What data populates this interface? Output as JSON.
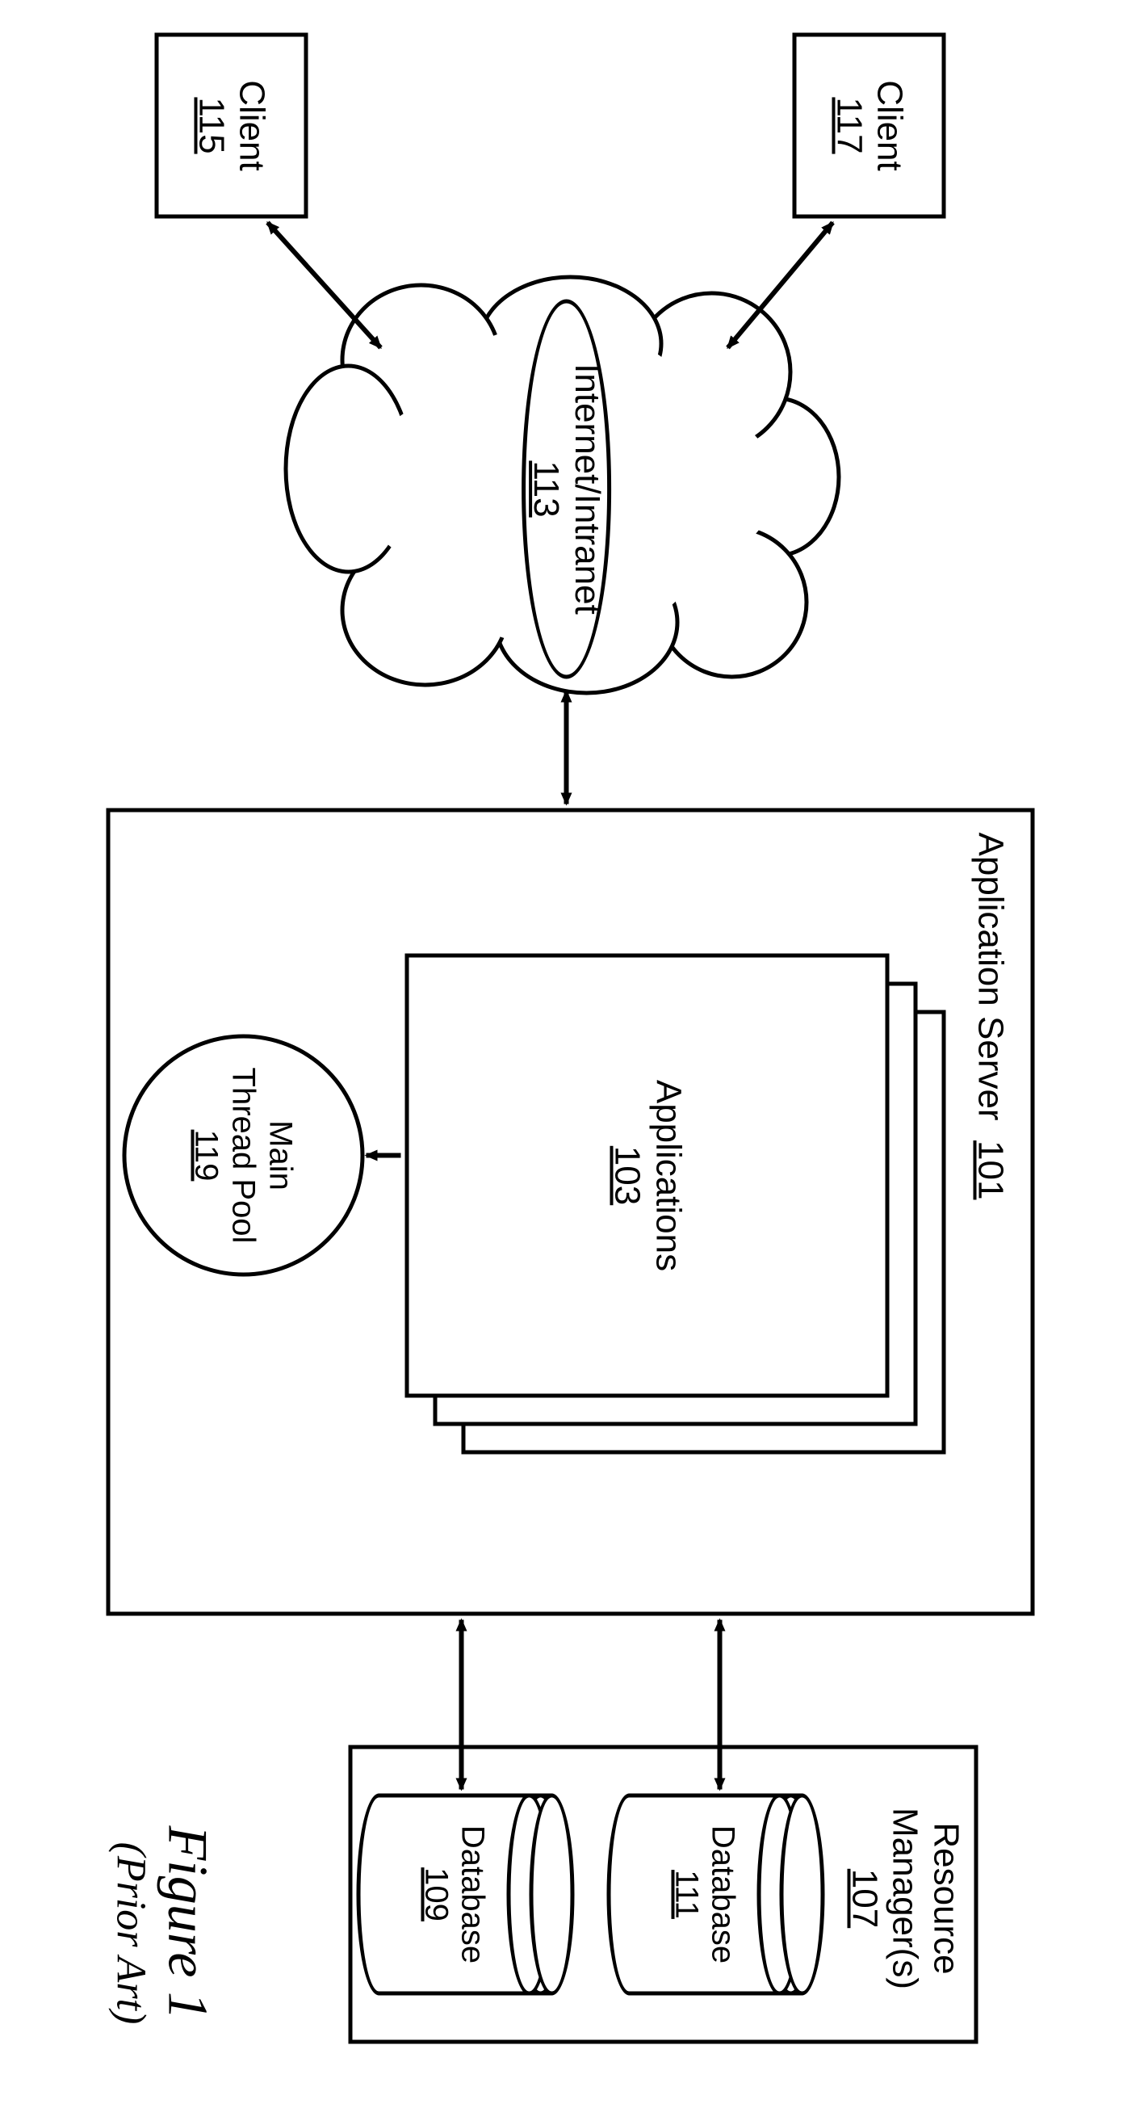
{
  "clients": [
    {
      "label": "Client",
      "id": "117"
    },
    {
      "label": "Client",
      "id": "115"
    }
  ],
  "network": {
    "label": "Internet/Intranet",
    "id": "113"
  },
  "app_server": {
    "title": "Application Server",
    "id": "101",
    "applications": {
      "label": "Applications",
      "id": "103"
    },
    "thread_pool": {
      "line1": "Main",
      "line2": "Thread Pool",
      "id": "119"
    }
  },
  "resource_manager": {
    "title": "Resource\nManager(s)",
    "id": "107",
    "databases": [
      {
        "label": "Database",
        "id": "111"
      },
      {
        "label": "Database",
        "id": "109"
      }
    ]
  },
  "figure": {
    "title": "Figure 1",
    "subtitle": "(Prior Art)"
  }
}
